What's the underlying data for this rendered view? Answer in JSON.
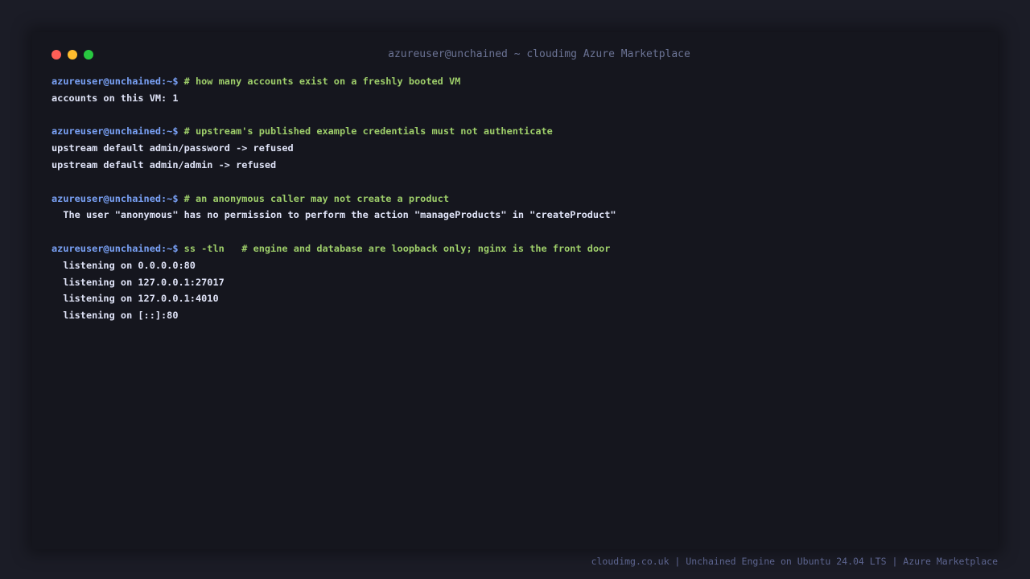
{
  "window": {
    "title": "azureuser@unchained ~ cloudimg Azure Marketplace",
    "colors": {
      "background": "#15161e",
      "prompt": "#7aa2f7",
      "command": "#9ece6a",
      "output": "#dfe3f7",
      "close": "#ff5f57",
      "minimize": "#febc2e",
      "maximize": "#28c840"
    },
    "buttons": [
      "close-dot",
      "minimize-dot",
      "maximize-dot"
    ]
  },
  "terminal": {
    "blocks": [
      {
        "prompt": "azureuser@unchained:~$",
        "command": "# how many accounts exist on a freshly booted VM",
        "output": [
          "accounts on this VM: 1"
        ]
      },
      {
        "prompt": "azureuser@unchained:~$",
        "command": "# upstream's published example credentials must not authenticate",
        "output": [
          "upstream default admin/password -> refused",
          "upstream default admin/admin -> refused"
        ]
      },
      {
        "prompt": "azureuser@unchained:~$",
        "command": "# an anonymous caller may not create a product",
        "output": [
          "  The user \"anonymous\" has no permission to perform the action \"manageProducts\" in \"createProduct\""
        ]
      },
      {
        "prompt": "azureuser@unchained:~$",
        "command": "ss -tln   # engine and database are loopback only; nginx is the front door",
        "output": [
          "  listening on 0.0.0.0:80",
          "  listening on 127.0.0.1:27017",
          "  listening on 127.0.0.1:4010",
          "  listening on [::]:80"
        ]
      }
    ]
  },
  "footer": {
    "text": "cloudimg.co.uk | Unchained Engine on Ubuntu 24.04 LTS | Azure Marketplace"
  }
}
